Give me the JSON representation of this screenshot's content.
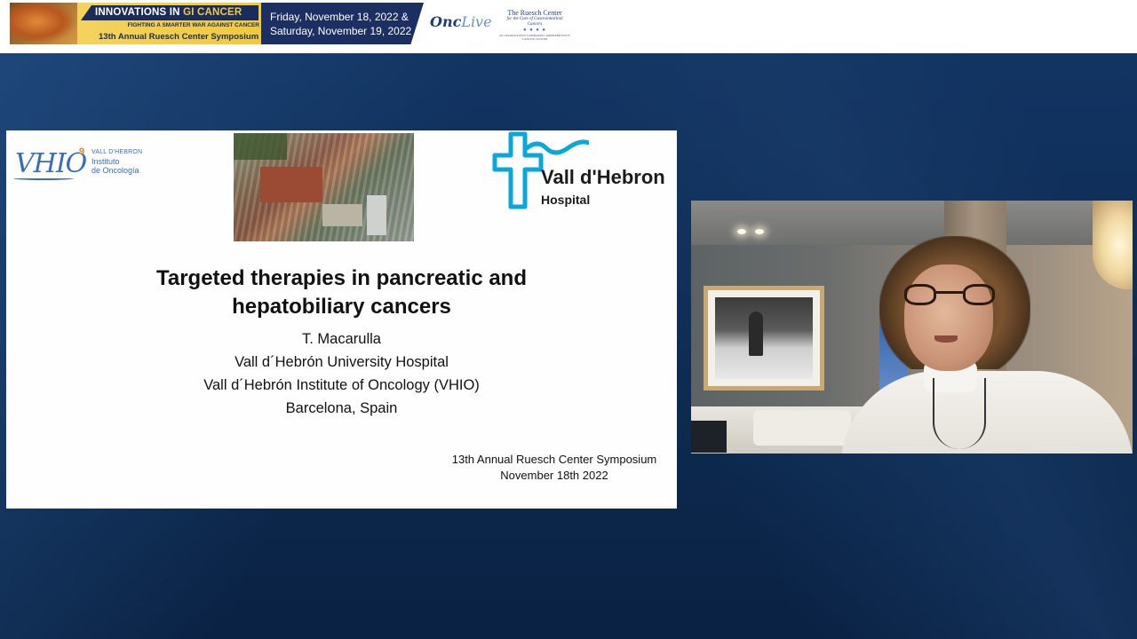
{
  "banner": {
    "event_title_a": "INNOVATIONS IN ",
    "event_title_b": "GI CANCER",
    "event_subtitle": "FIGHTING A SMARTER WAR AGAINST CANCER",
    "symposium": "13th Annual Ruesch Center Symposium",
    "date_line1": "Friday, November 18, 2022 &",
    "date_line2": "Saturday, November 19, 2022",
    "onclive_a": "Onc",
    "onclive_b": "Live",
    "ruesch_name": "The Ruesch Center",
    "ruesch_tagline": "for the Cure of Gastrointestinal Cancers",
    "ruesch_dots": "● ● ● ●",
    "ruesch_affiliation": "AT GEORGETOWN LOMBARDI COMPREHENSIVE CANCER CENTER"
  },
  "slide": {
    "vhio_logo_text": "VHIO",
    "vhio_logo_mark": "9",
    "vhio_line1": "VALL D'HEBRON",
    "vhio_line2": "Instituto",
    "vhio_line3": "de Oncología",
    "hospital_name": "Vall d'Hebron",
    "hospital_sub": "Hospital",
    "title_line1": "Targeted therapies in pancreatic and",
    "title_line2": "hepatobiliary cancers",
    "author": "T. Macarulla",
    "affil1": "Vall d´Hebrón University Hospital",
    "affil2": "Vall d´Hebrón Institute of Oncology (VHIO)",
    "location": "Barcelona, Spain",
    "footer_line1": "13th Annual Ruesch Center Symposium",
    "footer_line2": "November 18th 2022"
  },
  "colors": {
    "stage_bg": "#0e2a4c",
    "banner_navy": "#1b2f62",
    "banner_gold": "#f0c93c",
    "vhio_blue": "#3a6db3",
    "vh_cyan": "#0aa7d8"
  }
}
